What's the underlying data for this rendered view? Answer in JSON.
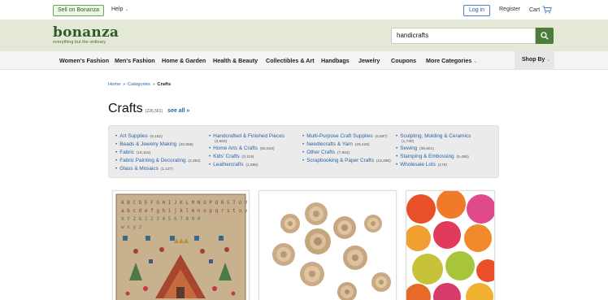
{
  "topbar": {
    "sell_label": "Sell on Bonanza",
    "help_label": "Help",
    "login_label": "Log in",
    "register_label": "Register",
    "cart_label": "Cart"
  },
  "header": {
    "logo_name": "bonanza",
    "logo_tagline": "everything but the ordinary",
    "search_value": "handicrafts"
  },
  "nav": {
    "items": [
      "Women's Fashion",
      "Men's Fashion",
      "Home & Garden",
      "Health & Beauty",
      "Collectibles & Art",
      "Handbags",
      "Jewelry",
      "Coupons",
      "More Categories"
    ],
    "shop_by": "Shop By"
  },
  "breadcrumb": {
    "home": "Home",
    "categories": "Categories",
    "current": "Crafts"
  },
  "page": {
    "title": "Crafts",
    "count": "(226,561)",
    "see_all": "see all »"
  },
  "categories": {
    "col1": [
      {
        "label": "Art Supplies",
        "count": "(8,162)"
      },
      {
        "label": "Beads & Jewelry Making",
        "count": "(20,958)"
      },
      {
        "label": "Fabric",
        "count": "(18,116)"
      },
      {
        "label": "Fabric Painting & Decorating",
        "count": "(2,363)"
      },
      {
        "label": "Glass & Mosaics",
        "count": "(1,137)"
      }
    ],
    "col2": [
      {
        "label": "Handcrafted & Finished Pieces",
        "count": "(3,663)"
      },
      {
        "label": "Home Arts & Crafts",
        "count": "(55,916)"
      },
      {
        "label": "Kids' Crafts",
        "count": "(3,119)"
      },
      {
        "label": "Leathercrafts",
        "count": "(1,985)"
      }
    ],
    "col3": [
      {
        "label": "Multi-Purpose Craft Supplies",
        "count": "(6,597)"
      },
      {
        "label": "Needlecrafts & Yarn",
        "count": "(29,428)"
      },
      {
        "label": "Other Crafts",
        "count": "(7,604)"
      },
      {
        "label": "Scrapbooking & Paper Crafts",
        "count": "(18,496)"
      }
    ],
    "col4": [
      {
        "label": "Sculpting, Molding & Ceramics",
        "count": "(1,730)"
      },
      {
        "label": "Sewing",
        "count": "(39,601)"
      },
      {
        "label": "Stamping & Embossing",
        "count": "(5,466)"
      },
      {
        "label": "Wholesale Lots",
        "count": "(176)"
      }
    ]
  },
  "products": [
    {
      "icon": "cross-stitch-sampler-image"
    },
    {
      "icon": "ceramic-roses-image"
    },
    {
      "icon": "felt-balls-image"
    }
  ],
  "colors": {
    "brand_green": "#2f5b24",
    "header_bg": "#e4e8d6",
    "link_blue": "#2a64a6",
    "search_button": "#4d7d3a"
  }
}
